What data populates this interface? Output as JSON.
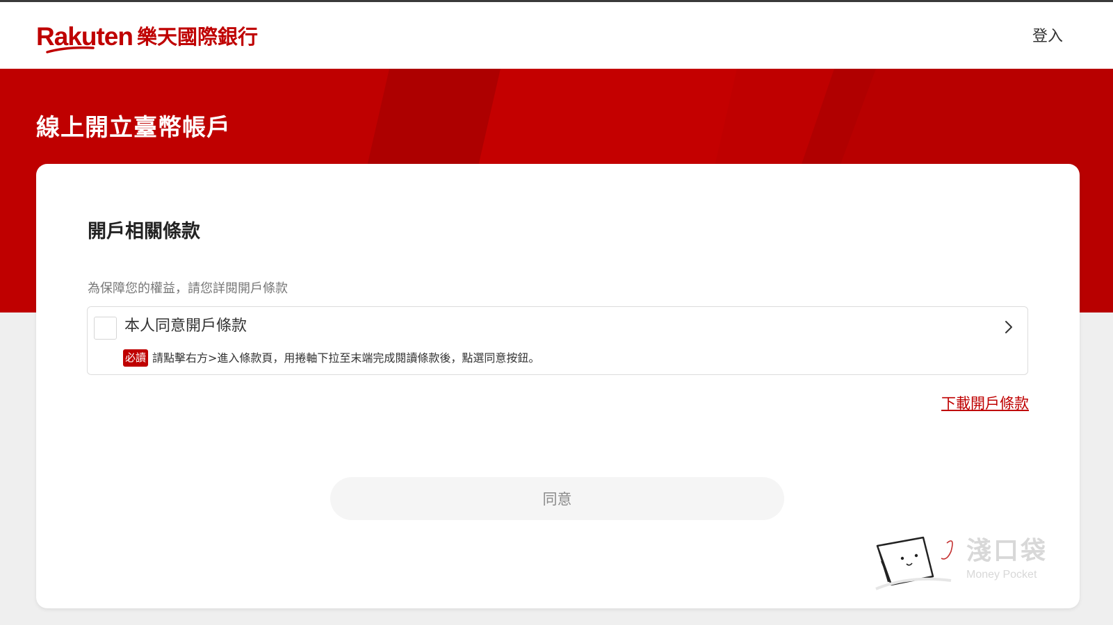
{
  "brand": {
    "logo_text_en": "Rakuten",
    "logo_text_zh": "樂天國際銀行",
    "primary_color": "#bf0000"
  },
  "header": {
    "login_label": "登入"
  },
  "banner": {
    "title": "線上開立臺幣帳戶"
  },
  "card": {
    "section_title": "開戶相關條款",
    "subtitle": "為保障您的權益，請您詳閱開戶條款",
    "terms_item": {
      "label": "本人同意開戶條款",
      "badge": "必讀",
      "instruction": "請點擊右方>進入條款頁，用捲軸下拉至末端完成閱讀條款後，點選同意按鈕。",
      "checked": false
    },
    "download_link": "下載開戶條款",
    "agree_button": "同意"
  },
  "watermark": {
    "title": "淺口袋",
    "subtitle": "Money Pocket"
  }
}
